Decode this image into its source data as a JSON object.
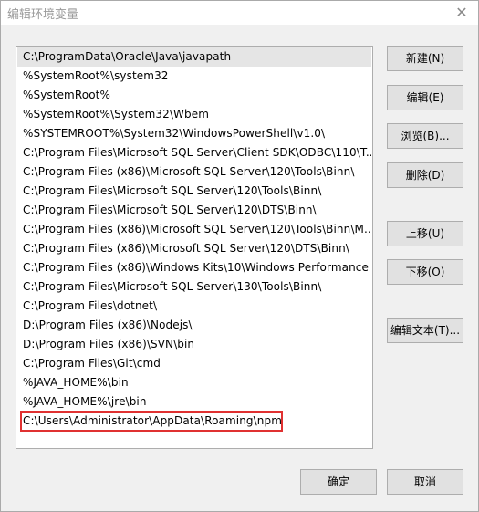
{
  "window": {
    "title": "编辑环境变量",
    "close_glyph": "✕"
  },
  "path_list": {
    "entries": [
      "C:\\ProgramData\\Oracle\\Java\\javapath",
      "%SystemRoot%\\system32",
      "%SystemRoot%",
      "%SystemRoot%\\System32\\Wbem",
      "%SYSTEMROOT%\\System32\\WindowsPowerShell\\v1.0\\",
      "C:\\Program Files\\Microsoft SQL Server\\Client SDK\\ODBC\\110\\T...",
      "C:\\Program Files (x86)\\Microsoft SQL Server\\120\\Tools\\Binn\\",
      "C:\\Program Files\\Microsoft SQL Server\\120\\Tools\\Binn\\",
      "C:\\Program Files\\Microsoft SQL Server\\120\\DTS\\Binn\\",
      "C:\\Program Files (x86)\\Microsoft SQL Server\\120\\Tools\\Binn\\M...",
      "C:\\Program Files (x86)\\Microsoft SQL Server\\120\\DTS\\Binn\\",
      "C:\\Program Files (x86)\\Windows Kits\\10\\Windows Performance ...",
      "C:\\Program Files\\Microsoft SQL Server\\130\\Tools\\Binn\\",
      "C:\\Program Files\\dotnet\\",
      "D:\\Program Files (x86)\\Nodejs\\",
      "D:\\Program Files (x86)\\SVN\\bin",
      "C:\\Program Files\\Git\\cmd",
      "%JAVA_HOME%\\bin",
      "%JAVA_HOME%\\jre\\bin",
      "C:\\Users\\Administrator\\AppData\\Roaming\\npm"
    ],
    "selected_index": 0,
    "editing_index": 19
  },
  "buttons": {
    "new": "新建(N)",
    "edit": "编辑(E)",
    "browse": "浏览(B)...",
    "delete": "删除(D)",
    "move_up": "上移(U)",
    "move_down": "下移(O)",
    "edit_text": "编辑文本(T)...",
    "ok": "确定",
    "cancel": "取消"
  },
  "colors": {
    "highlight_border": "#e03131",
    "selected_row": "#e5e5e5"
  }
}
